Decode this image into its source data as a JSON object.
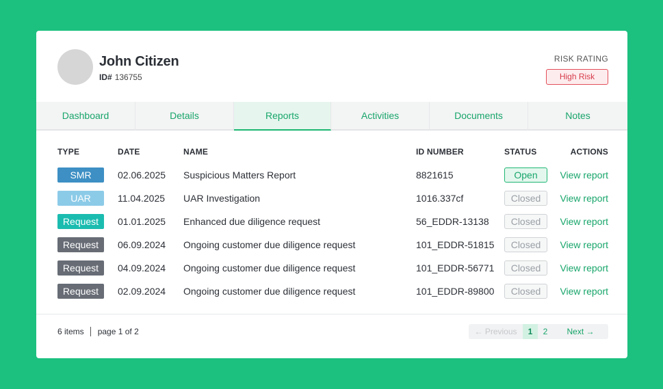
{
  "profile": {
    "name": "John Citizen",
    "id_label": "ID#",
    "id_value": "136755",
    "risk_label": "RISK RATING",
    "risk_value": "High Risk"
  },
  "tabs": [
    {
      "label": "Dashboard",
      "active": false
    },
    {
      "label": "Details",
      "active": false
    },
    {
      "label": "Reports",
      "active": true
    },
    {
      "label": "Activities",
      "active": false
    },
    {
      "label": "Documents",
      "active": false
    },
    {
      "label": "Notes",
      "active": false
    }
  ],
  "table": {
    "headers": {
      "type": "TYPE",
      "date": "DATE",
      "name": "NAME",
      "id": "ID NUMBER",
      "status": "STATUS",
      "actions": "ACTIONS"
    },
    "rows": [
      {
        "type": "SMR",
        "type_color": "#3d8fc4",
        "date": "02.06.2025",
        "name": "Suspicious Matters Report",
        "id": "8821615",
        "status": "Open",
        "action": "View report"
      },
      {
        "type": "UAR",
        "type_color": "#8ccbe8",
        "date": "11.04.2025",
        "name": "UAR Investigation",
        "id": "1016.337cf",
        "status": "Closed",
        "action": "View report"
      },
      {
        "type": "Request",
        "type_color": "#1bbcb0",
        "date": "01.01.2025",
        "name": "Enhanced due diligence request",
        "id": "56_EDDR-13138",
        "status": "Closed",
        "action": "View report"
      },
      {
        "type": "Request",
        "type_color": "#676c75",
        "date": "06.09.2024",
        "name": "Ongoing customer due diligence request",
        "id": "101_EDDR-51815",
        "status": "Closed",
        "action": "View report"
      },
      {
        "type": "Request",
        "type_color": "#676c75",
        "date": "04.09.2024",
        "name": "Ongoing customer due diligence request",
        "id": "101_EDDR-56771",
        "status": "Closed",
        "action": "View report"
      },
      {
        "type": "Request",
        "type_color": "#676c75",
        "date": "02.09.2024",
        "name": "Ongoing customer due diligence request",
        "id": "101_EDDR-89800",
        "status": "Closed",
        "action": "View report"
      }
    ]
  },
  "footer": {
    "items_count": "6 items",
    "page_info": "page 1 of 2",
    "prev_label": "Previous",
    "next_label": "Next",
    "pages": [
      "1",
      "2"
    ],
    "current_page": "1"
  },
  "colors": {
    "background": "#1cc07f",
    "accent": "#17a56a",
    "risk": "#d63c4a"
  },
  "icons": {
    "prev": "arrow-left-icon",
    "next": "arrow-right-icon"
  }
}
